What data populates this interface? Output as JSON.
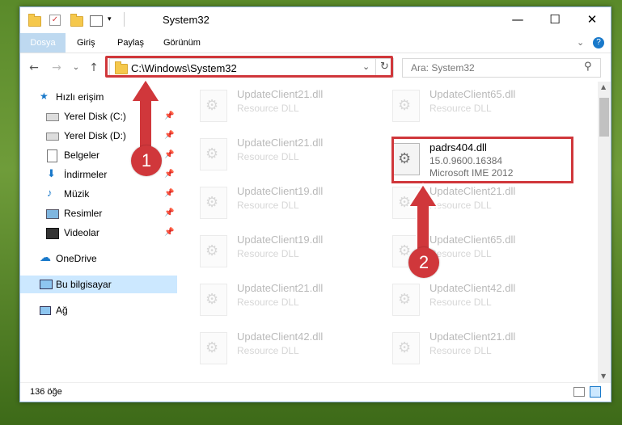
{
  "window": {
    "title": "System32",
    "minimize": "—",
    "maximize": "☐",
    "close": "✕"
  },
  "ribbon": {
    "tabs": [
      "Dosya",
      "Giriş",
      "Paylaş",
      "Görünüm"
    ],
    "expand": "⌄",
    "help": "?"
  },
  "nav": {
    "back": "←",
    "forward": "→",
    "recent": "⌄",
    "up": "↑",
    "address": "C:\\Windows\\System32",
    "dropdown": "⌄",
    "refresh": "↻",
    "search_placeholder": "Ara: System32",
    "search_icon": "⚲"
  },
  "sidebar": {
    "quick_access": "Hızlı erişim",
    "items": [
      {
        "label": "Yerel Disk (C:)",
        "icon": "drive-icon"
      },
      {
        "label": "Yerel Disk (D:)",
        "icon": "drive-icon"
      },
      {
        "label": "Belgeler",
        "icon": "documents-icon"
      },
      {
        "label": "İndirmeler",
        "icon": "downloads-icon"
      },
      {
        "label": "Müzik",
        "icon": "music-icon"
      },
      {
        "label": "Resimler",
        "icon": "pictures-icon"
      },
      {
        "label": "Videolar",
        "icon": "videos-icon"
      }
    ],
    "onedrive": "OneDrive",
    "this_pc": "Bu bilgisayar",
    "network": "Ağ",
    "pin": "📌"
  },
  "files": {
    "left": [
      {
        "name": "UpdateClient21.dll",
        "desc": "Resource DLL"
      },
      {
        "name": "UpdateClient21.dll",
        "desc": "Resource DLL"
      },
      {
        "name": "UpdateClient19.dll",
        "desc": "Resource DLL"
      },
      {
        "name": "UpdateClient19.dll",
        "desc": "Resource DLL"
      },
      {
        "name": "UpdateClient21.dll",
        "desc": "Resource DLL"
      },
      {
        "name": "UpdateClient42.dll",
        "desc": "Resource DLL"
      }
    ],
    "right": [
      {
        "name": "UpdateClient65.dll",
        "desc": "Resource DLL"
      },
      {
        "name": "UpdateClient21.dll",
        "desc": "Resource DLL"
      },
      {
        "name": "UpdateClient65.dll",
        "desc": "Resource DLL"
      },
      {
        "name": "UpdateClient42.dll",
        "desc": "Resource DLL"
      },
      {
        "name": "UpdateClient21.dll",
        "desc": "Resource DLL"
      }
    ],
    "highlighted": {
      "name": "padrs404.dll",
      "version": "15.0.9600.16384",
      "desc": "Microsoft IME 2012"
    }
  },
  "annotations": {
    "badge1": "1",
    "badge2": "2",
    "color": "#d0373b"
  },
  "status": {
    "count": "136 öğe"
  }
}
